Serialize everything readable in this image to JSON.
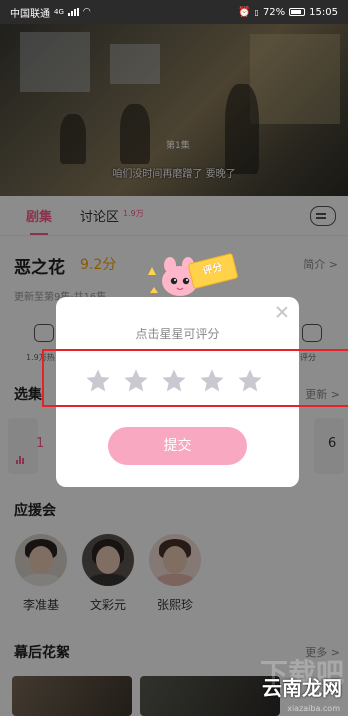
{
  "status_bar": {
    "carrier": "中国联通",
    "network": "4G",
    "battery": "72%",
    "time": "15:05"
  },
  "video": {
    "episode_tag": "第1集",
    "subtitle": "咱们没时间再磨蹭了 要晚了"
  },
  "tabs": [
    {
      "label": "剧集"
    },
    {
      "label": "讨论区",
      "count": "1.9万"
    }
  ],
  "show": {
    "title": "恶之花",
    "score": "9.2分",
    "intro_link": "简介 >",
    "update_text": "更新至第9集·共16集"
  },
  "actions": {
    "comment_label": "1.9万热",
    "rate_label": "评分"
  },
  "episodes": {
    "section_title": "选集",
    "more_link": "更新 >",
    "first": "1",
    "last": "6"
  },
  "cast": {
    "section_title": "应援会",
    "members": [
      {
        "name": "李准基"
      },
      {
        "name": "文彩元"
      },
      {
        "name": "张熙珍"
      }
    ]
  },
  "extras": {
    "section_title": "幕后花絮",
    "more_link": "更多 >"
  },
  "rating_dialog": {
    "prompt": "点击星星可评分",
    "star_count": 5,
    "submit_label": "提交",
    "tag_label": "评分"
  },
  "watermark": {
    "brand": "云南龙网",
    "url": "xiazaiba.com"
  },
  "colors": {
    "accent": "#ff5e8a",
    "score": "#ff9f0a",
    "submit_bg": "#f9a8c2",
    "star_empty": "#c9c9d1",
    "highlight": "#e5212a"
  }
}
